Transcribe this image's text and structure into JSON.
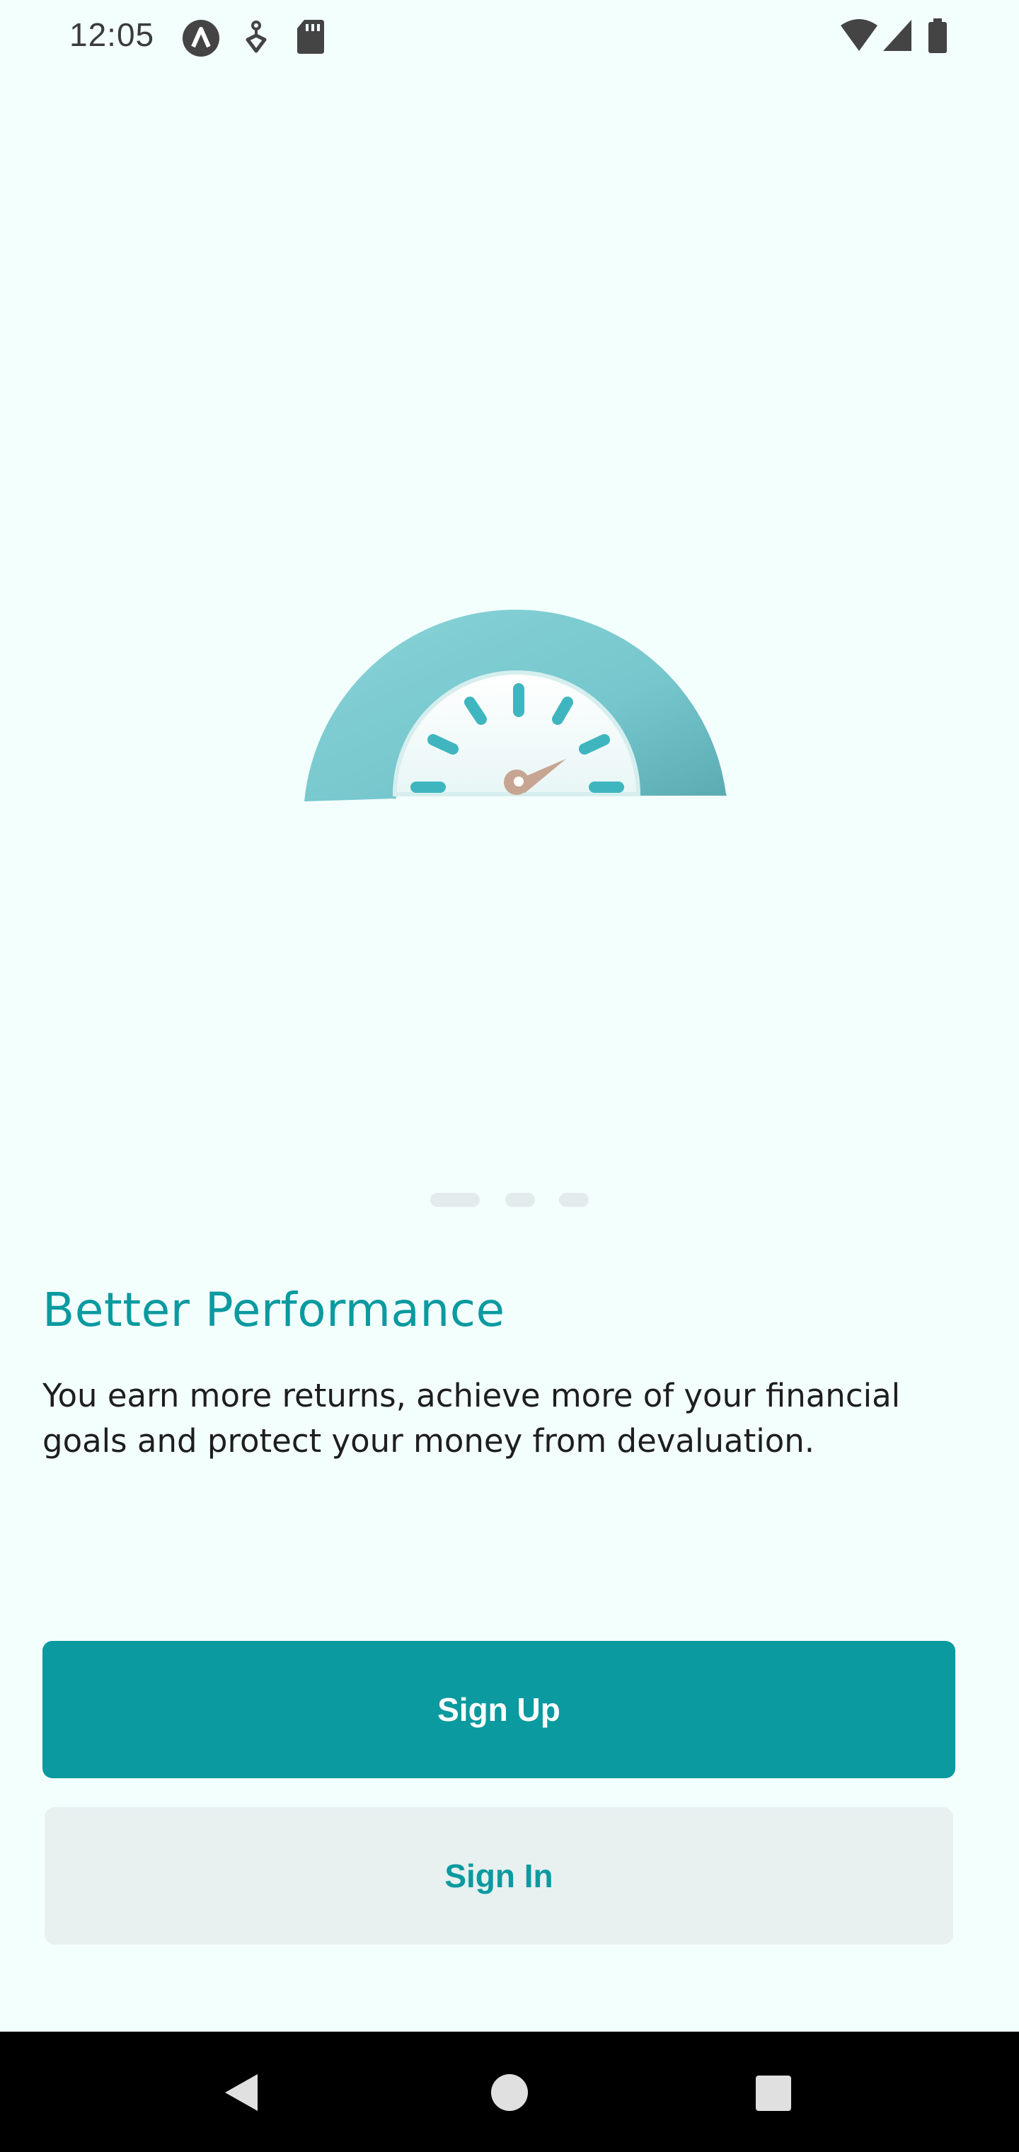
{
  "status_bar": {
    "time": "12:05",
    "icons_left": [
      "accessibility-a-icon",
      "usb-debug-icon",
      "sd-card-icon"
    ],
    "icons_right": [
      "wifi-icon",
      "cell-signal-icon",
      "battery-icon"
    ]
  },
  "hero": {
    "illustration": "speedometer-gauge-icon"
  },
  "pager": {
    "total_pages": 3,
    "active_index": 0
  },
  "onboarding": {
    "title": "Better Performance",
    "description": "You earn more returns, achieve more of your financial goals and protect your money from devaluation."
  },
  "actions": {
    "sign_up_label": "Sign Up",
    "sign_in_label": "Sign In"
  },
  "nav_bar": {
    "icons": [
      "back-icon",
      "home-icon",
      "recents-icon"
    ]
  },
  "colors": {
    "background": "#f3fffd",
    "accent": "#0a9a9f",
    "secondary_button": "#e8f0f0",
    "gauge": "#7ccdd3"
  }
}
